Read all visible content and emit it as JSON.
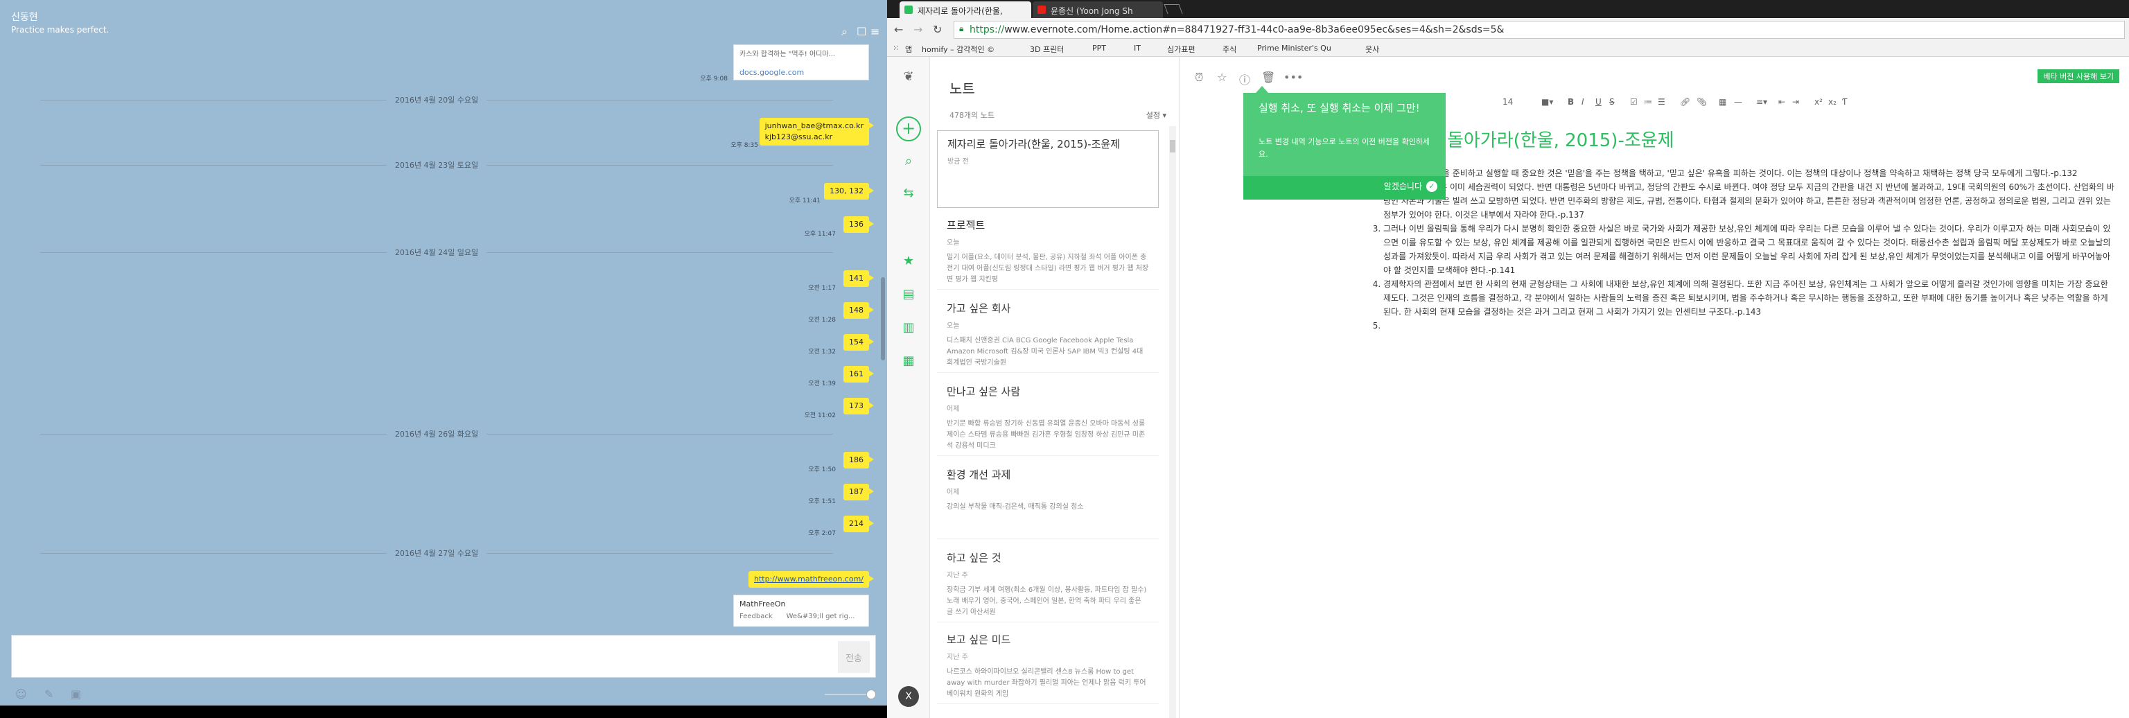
{
  "chat": {
    "title": "신동현",
    "subtitle": "Practice makes perfect.",
    "icons": [
      "search-icon",
      "notice-icon",
      "menu-icon"
    ],
    "top_card": {
      "text": "카스와 합격하는 \"먹주! 어디마...",
      "link": "docs.google.com",
      "time": "오후 9:08"
    },
    "dates": [
      "2016년 4월 20일 수요일",
      "2016년 4월 23일 토요일",
      "2016년 4월 24일 일요일",
      "2016년 4월 26일 화요일",
      "2016년 4월 27일 수요일"
    ],
    "messages": [
      {
        "text": "junhwan_bae@tmax.co.kr",
        "text2": "kjb123@ssu.ac.kr",
        "time": "오후 8:35"
      },
      {
        "text": "130, 132",
        "time": "오후 11:41"
      },
      {
        "text": "136",
        "time": "오후 11:47"
      },
      {
        "text": "141",
        "time": "오전 1:17"
      },
      {
        "text": "148",
        "time": "오전 1:28"
      },
      {
        "text": "154",
        "time": "오전 1:32"
      },
      {
        "text": "161",
        "time": "오전 1:39"
      },
      {
        "text": "173",
        "time": "오전 11:02"
      },
      {
        "text": "186",
        "time": "오후 1:50"
      },
      {
        "text": "187",
        "time": "오후 1:51"
      },
      {
        "text": "214",
        "time": "오후 2:07"
      },
      {
        "text": "http://www.mathfreeon.com/",
        "time": ""
      }
    ],
    "link_card": {
      "title": "MathFreeOn",
      "left": "Feedback",
      "right": "We&#39;ll get rig..."
    },
    "send_label": "전송"
  },
  "browser": {
    "tabs": [
      {
        "label": "제자리로 돌아가라(한울,",
        "color": "#2dbe60",
        "active": true
      },
      {
        "label": "윤종신 (Yoon Jong Sh",
        "color": "#e62117",
        "active": false
      }
    ],
    "url_https": "https://",
    "url_rest": "www.evernote.com/Home.action#n=88471927-ff31-44c0-aa9e-8b3a6ee095ec&ses=4&sh=2&sds=5&",
    "bookmarks": [
      "앱",
      "homify – 감각적인 ©",
      "3D 프린터",
      "PPT",
      "IT",
      "심가표편",
      "주식",
      "Prime Minister's Qu",
      "웃사"
    ]
  },
  "evernote": {
    "list_title": "노트",
    "count": "478개의 노트",
    "sort": "설정 ▾",
    "notes": [
      {
        "title": "제자리로 돌아가라(한울, 2015)-조윤제",
        "date": "방금 전",
        "snippet": ""
      },
      {
        "title": "프로젝트",
        "date": "오늘",
        "snippet": "밀기 어플(요소, 데이터 분석, 물판, 공유) 지하철 좌석 어플 아이폰 충전기 대여 어플(신도림 링정대 스타일) 라면 평가 웹 버거 평가 웹 처장면 평가 웹 치킨평"
      },
      {
        "title": "가고 싶은 회사",
        "date": "오늘",
        "snippet": "디스패치 신앤중권 CIA BCG Google Facebook Apple Tesla Amazon Microsoft 김&장 미국 인론사 SAP IBM 빅3 컨설팅 4대 회계법인 국방기술원"
      },
      {
        "title": "만나고 싶은 사람",
        "date": "어제",
        "snippet": "반기문 빠합 류승범 장기하 신동엽 유희열 윤종신 오바마 마동석 성룡 제이슨 스타뎀 류승용 빠빠원 김가흔 우형철 임창정 하상 김민규 미존석 강용석 미디크"
      },
      {
        "title": "환경 개선 과제",
        "date": "어제",
        "snippet": "강의실 부착물 매직-검은색, 매직통 강의실 청소"
      },
      {
        "title": "하고 싶은 것",
        "date": "지난 주",
        "snippet": "장학금 기부 세계 여행(최소 6개월 이상, 봉사활동, 파트타임 잡 필수) 노래 배우기 영어, 중국어, 스페인어 일본, 한역 축하 파티 우리 좋은 글 쓰기 아산서원"
      },
      {
        "title": "보고 싶은 미드",
        "date": "지난 주",
        "snippet": "나르코스 하와이파이브오 실리콘밸리 센스8 뉴스룸 How to get away with murder 좌잡하기 필리멀 피아는 언제나 맑음 럭키 투어 베이워치 원화의 게임"
      }
    ],
    "beta_label": "베타 버전 사용해 보기",
    "font_size": "14",
    "note_title": "제자리로 돌아가라(한울, 2015)-조윤제",
    "items": [
      "어떤 시대건 정책을 준비하고 실행할 때 중요한 것은 '믿음'을 주는 정책을 택하고, '믿고 싶은' 유혹을 피하는 것이다. 이는 정책의 대상이나 정책을 약속하고 채택하는 정책 당국 모두에게 그렇다.-p.132",
      "한국의 시장권력은 이미 세습권력이 되었다. 반면 대통령은 5년마다 바뀌고, 정당의 간판도 수시로 바뀐다. 여야 정당 모두 지금의 간판을 내건 지 반년에 불과하고, 19대 국회의원의 60%가 초선이다. 산업화의 바탕인 자본과 기술은 빌려 쓰고 모방하면 되었다. 반면 민주화의 방향은 제도, 규범, 전통이다. 타협과 절제의 문화가 있어야 하고, 튼튼한 정당과 객관적이며 엄정한 언론, 공정하고 정의로운 법원, 그리고 권위 있는 정부가 있어야 한다. 이것은 내부에서 자라야 한다.-p.137",
      "그러나 이번 올림픽을 통해 우리가 다시 분명히 확인한 중요한 사실은 바로 국가와 사회가 제공한 보상,유인 체계에 따라 우리는 다른 모습을 이루어 낼 수 있다는 것이다. 우리가 이루고자 하는 미래 사회모습이 있으면 이를 유도할 수 있는 보상, 유인 체계를 제공해 이를 일관되게 집행하면 국민은 반드시 이에 반응하고 결국 그 목표대로 움직여 갈 수 있다는 것이다. 태릉선수촌 설립과 올림픽 메달 포상제도가 바로 오늘날의 성과를 가져왔듯이. 따라서 지금 우리 사회가 겪고 있는 여러 문제를 해결하기 위해서는 먼저 이런 문제들이 오늘날 우리 사회에 자리 잡게 된 보상,유인 체계가 무엇이었는지를 분석해내고 이를 어떻게 바꾸어놓아야 할 것인지를 모색해야 한다.-p.141",
      "경제학자의 관점에서 보면 한 사회의 현재 균형상태는 그 사회에 내재한 보상,유인 체계에 의해 결정된다. 또한 지금 주어진 보상, 유인체계는 그 사회가 앞으로 어떻게 흘러갈 것인가에 영향을 미치는 가장 중요한 제도다. 그것은 인재의 흐름을 결정하고, 각 분야에서 일하는 사람들의 노력을 증진 혹은 퇴보시키며, 법을 주수하거나 혹은 무시하는 행동을 조장하고, 또한 부패에 대한 동기를 높이거나 혹은 낮추는 역할을 하게 된다. 한 사회의 현재 모습을 결정하는 것은 과거 그리고 현재 그 사회가 가지기 있는 인센티브 구조다.-p.143",
      ""
    ],
    "popup": {
      "title": "실행 취소, 또 실행 취소는 이제 그만!",
      "body": "노트 변경 내역 기능으로 노트의 이전 버전을 확인하세요.",
      "ok": "알겠습니다"
    },
    "avatar_letter": "X"
  }
}
